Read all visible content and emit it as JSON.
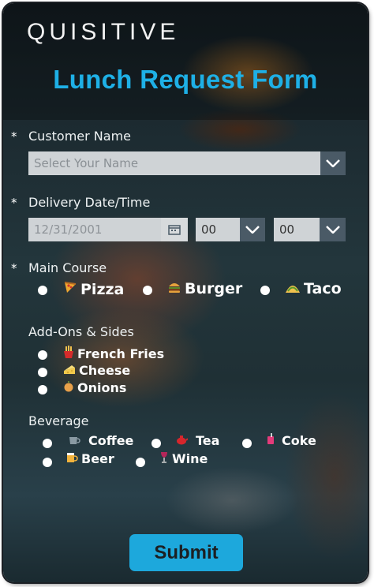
{
  "header": {
    "logo": "QUISITIVE",
    "title": "Lunch Request Form"
  },
  "form": {
    "customer_name": {
      "label": "Customer Name",
      "required_marker": "*",
      "placeholder": "Select Your Name"
    },
    "delivery": {
      "label": "Delivery Date/Time",
      "required_marker": "*",
      "date_placeholder": "12/31/2001",
      "hour": "00",
      "minute": "00"
    },
    "main_course": {
      "label": "Main Course",
      "required_marker": "*",
      "options": [
        {
          "label": "Pizza",
          "icon": "pizza-icon"
        },
        {
          "label": "Burger",
          "icon": "burger-icon"
        },
        {
          "label": "Taco",
          "icon": "taco-icon"
        }
      ]
    },
    "addons": {
      "label": "Add-Ons & Sides",
      "options": [
        {
          "label": "French Fries",
          "icon": "fries-icon"
        },
        {
          "label": "Cheese",
          "icon": "cheese-icon"
        },
        {
          "label": "Onions",
          "icon": "onion-icon"
        }
      ]
    },
    "beverage": {
      "label": "Beverage",
      "options": [
        {
          "label": "Coffee",
          "icon": "coffee-icon"
        },
        {
          "label": "Tea",
          "icon": "tea-icon"
        },
        {
          "label": "Coke",
          "icon": "coke-icon"
        },
        {
          "label": "Beer",
          "icon": "beer-icon"
        },
        {
          "label": "Wine",
          "icon": "wine-icon"
        }
      ]
    },
    "submit_label": "Submit"
  },
  "colors": {
    "accent": "#1EB0E6",
    "button": "#1DA8DC",
    "input": "#CFD3D6",
    "dropdown": "#4A5A66"
  }
}
